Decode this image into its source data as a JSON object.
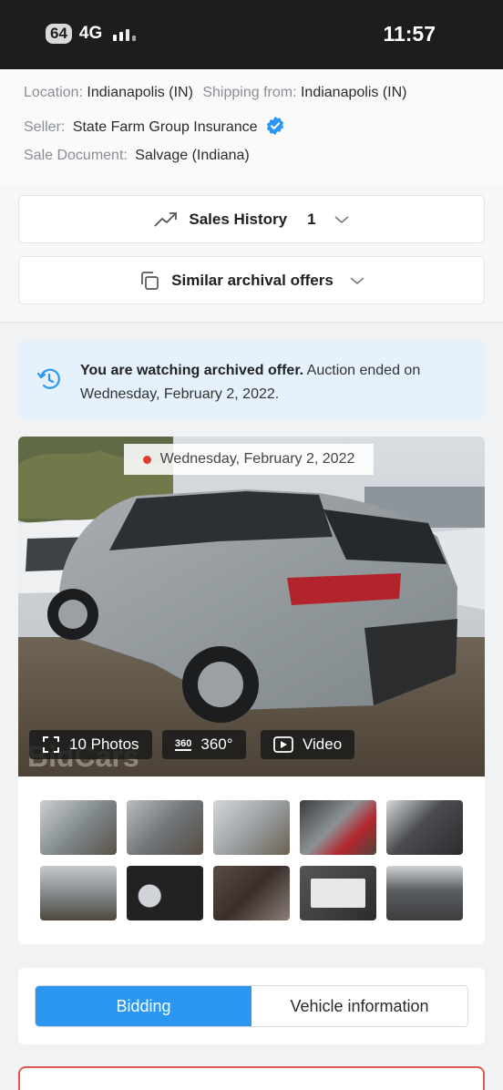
{
  "status_bar": {
    "battery": "64",
    "network": "4G",
    "time": "11:57"
  },
  "location": {
    "location_label": "Location:",
    "location_value": "Indianapolis (IN)",
    "shipping_label": "Shipping from:",
    "shipping_value": "Indianapolis (IN)",
    "seller_label": "Seller:",
    "seller_value": "State Farm Group Insurance",
    "document_label": "Sale Document:",
    "document_value": "Salvage (Indiana)"
  },
  "sales_history": {
    "label": "Sales History",
    "count": "1"
  },
  "similar_offers": {
    "label": "Similar archival offers"
  },
  "archive_notice": {
    "bold": "You are watching archived offer.",
    "text": " Auction ended on Wednesday, February 2, 2022."
  },
  "gallery": {
    "date": "Wednesday, February 2, 2022",
    "watermark": "BidCars",
    "photos_label": "10 Photos",
    "spin_badge": "360",
    "spin_label": "360°",
    "video_label": "Video",
    "thumbnails": [
      "front-left damage",
      "front-right",
      "right side",
      "rear open hatch",
      "interior front",
      "front",
      "instrument cluster",
      "rear seats",
      "label sticker",
      "engine bay"
    ]
  },
  "tabs": {
    "bidding": "Bidding",
    "vehicle_info": "Vehicle information"
  },
  "colors": {
    "accent": "#2b97f0",
    "banner_bg": "#e5f2fd",
    "live_dot": "#e53935",
    "alert_border": "#e0584f"
  }
}
